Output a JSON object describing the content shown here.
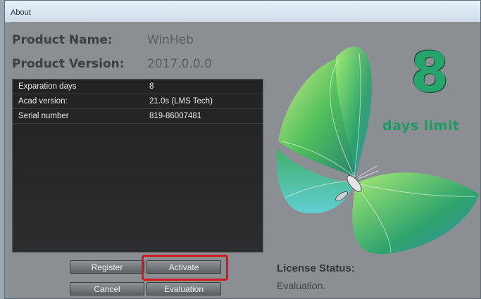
{
  "window": {
    "title": "About"
  },
  "product": {
    "name_label": "Product Name:",
    "name_value": "WinHeb",
    "version_label": "Product Version:",
    "version_value": "2017.0.0.0"
  },
  "info_rows": [
    {
      "key": "Exparation days",
      "value": "8"
    },
    {
      "key": "Acad version:",
      "value": "21.0s (LMS Tech)"
    },
    {
      "key": "Serial number",
      "value": "819-86007481"
    }
  ],
  "buttons": {
    "register": "Register",
    "activate": "Activate",
    "cancel": "Cancel",
    "evaluation": "Evaluation"
  },
  "license": {
    "label": "License Status:",
    "value": "Evaluation."
  },
  "promo": {
    "number": "8",
    "caption": "days limit"
  },
  "colors": {
    "highlight": "#d21b20",
    "accent_green": "#26a46c"
  },
  "icons": {
    "logo": "butterfly-logo-icon"
  }
}
